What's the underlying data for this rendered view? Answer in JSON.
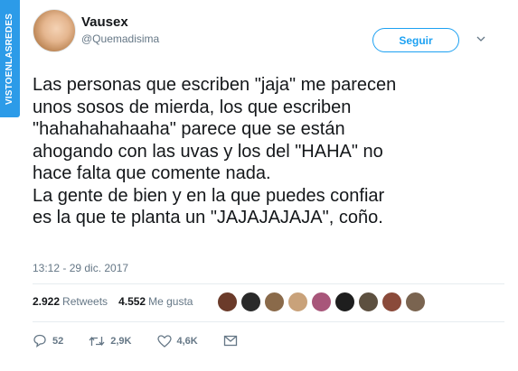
{
  "watermark": "VISTOENLASREDES",
  "author": {
    "name": "Vausex",
    "handle": "@Quemadisima"
  },
  "follow_button": "Seguir",
  "tweet_lines": [
    "Las personas que escriben \"jaja\" me parecen",
    "unos sosos de mierda, los que escriben",
    "\"hahahahahaaha\" parece que se están",
    "ahogando con las uvas y los del \"HAHA\" no",
    "hace falta que comente nada.",
    "La gente de bien y en la que puedes confiar",
    "es la que te planta un \"JAJAJAJAJA\", coño."
  ],
  "timestamp": "13:12 - 29 dic. 2017",
  "stats": {
    "retweets_count": "2.922",
    "retweets_label": "Retweets",
    "likes_count": "4.552",
    "likes_label": "Me gusta"
  },
  "liker_avatars": [
    {
      "icon": "avatar-1",
      "color": "#6b3b2a"
    },
    {
      "icon": "avatar-2",
      "color": "#2a2a2a"
    },
    {
      "icon": "avatar-3",
      "color": "#8a6a4a"
    },
    {
      "icon": "avatar-4",
      "color": "#c9a27a"
    },
    {
      "icon": "avatar-5",
      "color": "#a8567a"
    },
    {
      "icon": "avatar-6",
      "color": "#1e1e1e"
    },
    {
      "icon": "avatar-7",
      "color": "#5d5040"
    },
    {
      "icon": "avatar-8",
      "color": "#8a4a3a"
    },
    {
      "icon": "avatar-9",
      "color": "#7a6450"
    }
  ],
  "actions": {
    "replies": "52",
    "retweets": "2,9K",
    "likes": "4,6K"
  },
  "colors": {
    "accent": "#1da1f2",
    "watermark": "#2c9be8",
    "muted": "#657786"
  }
}
